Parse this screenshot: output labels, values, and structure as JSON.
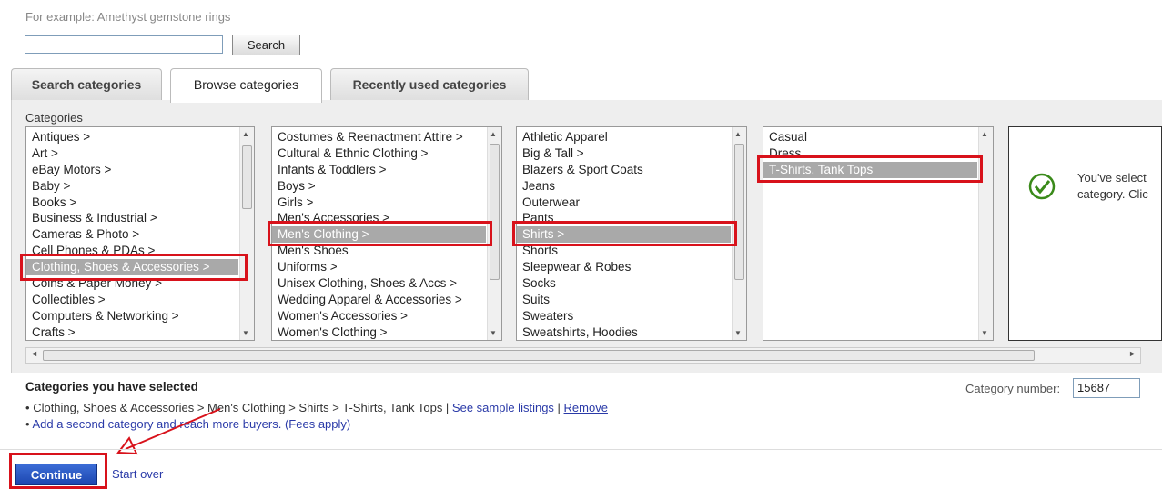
{
  "search": {
    "hint": "For example: Amethyst gemstone rings",
    "value": "",
    "button_label": "Search"
  },
  "tabs": [
    {
      "label": "Search categories",
      "active": false
    },
    {
      "label": "Browse categories",
      "active": true
    },
    {
      "label": "Recently used categories",
      "active": false
    }
  ],
  "categories_label": "Categories",
  "columns": [
    {
      "items": [
        "Antiques >",
        "Art >",
        "eBay Motors >",
        "Baby >",
        "Books >",
        "Business & Industrial >",
        "Cameras & Photo >",
        "Cell Phones & PDAs >",
        "Clothing, Shoes & Accessories >",
        "Coins & Paper Money >",
        "Collectibles >",
        "Computers & Networking >",
        "Crafts >"
      ],
      "selected": 8
    },
    {
      "items": [
        "Costumes & Reenactment Attire >",
        "Cultural & Ethnic Clothing >",
        "Infants & Toddlers >",
        "Boys >",
        "Girls >",
        "Men's Accessories >",
        "Men's Clothing >",
        "Men's Shoes",
        "Uniforms >",
        "Unisex Clothing, Shoes & Accs >",
        "Wedding Apparel & Accessories >",
        "Women's Accessories >",
        "Women's Clothing >"
      ],
      "selected": 6
    },
    {
      "items": [
        "Athletic Apparel",
        "Big & Tall >",
        "Blazers & Sport Coats",
        "Jeans",
        "Outerwear",
        "Pants",
        "Shirts >",
        "Shorts",
        "Sleepwear & Robes",
        "Socks",
        "Suits",
        "Sweaters",
        "Sweatshirts, Hoodies"
      ],
      "selected": 6
    },
    {
      "items": [
        "Casual",
        "Dress",
        "T-Shirts, Tank Tops"
      ],
      "selected": 2
    }
  ],
  "result": {
    "line1": "You've select",
    "line2": "category. Clic"
  },
  "selected_section": {
    "title": "Categories you have selected",
    "path": "Clothing, Shoes & Accessories > Men's Clothing > Shirts > T-Shirts, Tank Tops",
    "sep1": " | ",
    "see_sample": "See sample listings",
    "sep2": " | ",
    "remove": "Remove",
    "add_second": "Add a second category and reach more buyers.",
    "fees": " (Fees apply)",
    "bullet": "•"
  },
  "category_number": {
    "label": "Category number:",
    "value": "15687"
  },
  "actions": {
    "continue": "Continue",
    "start_over": "Start over"
  },
  "colors": {
    "highlight": "#d8121b",
    "link": "#2a3aa8",
    "button": "#1c46b0"
  }
}
